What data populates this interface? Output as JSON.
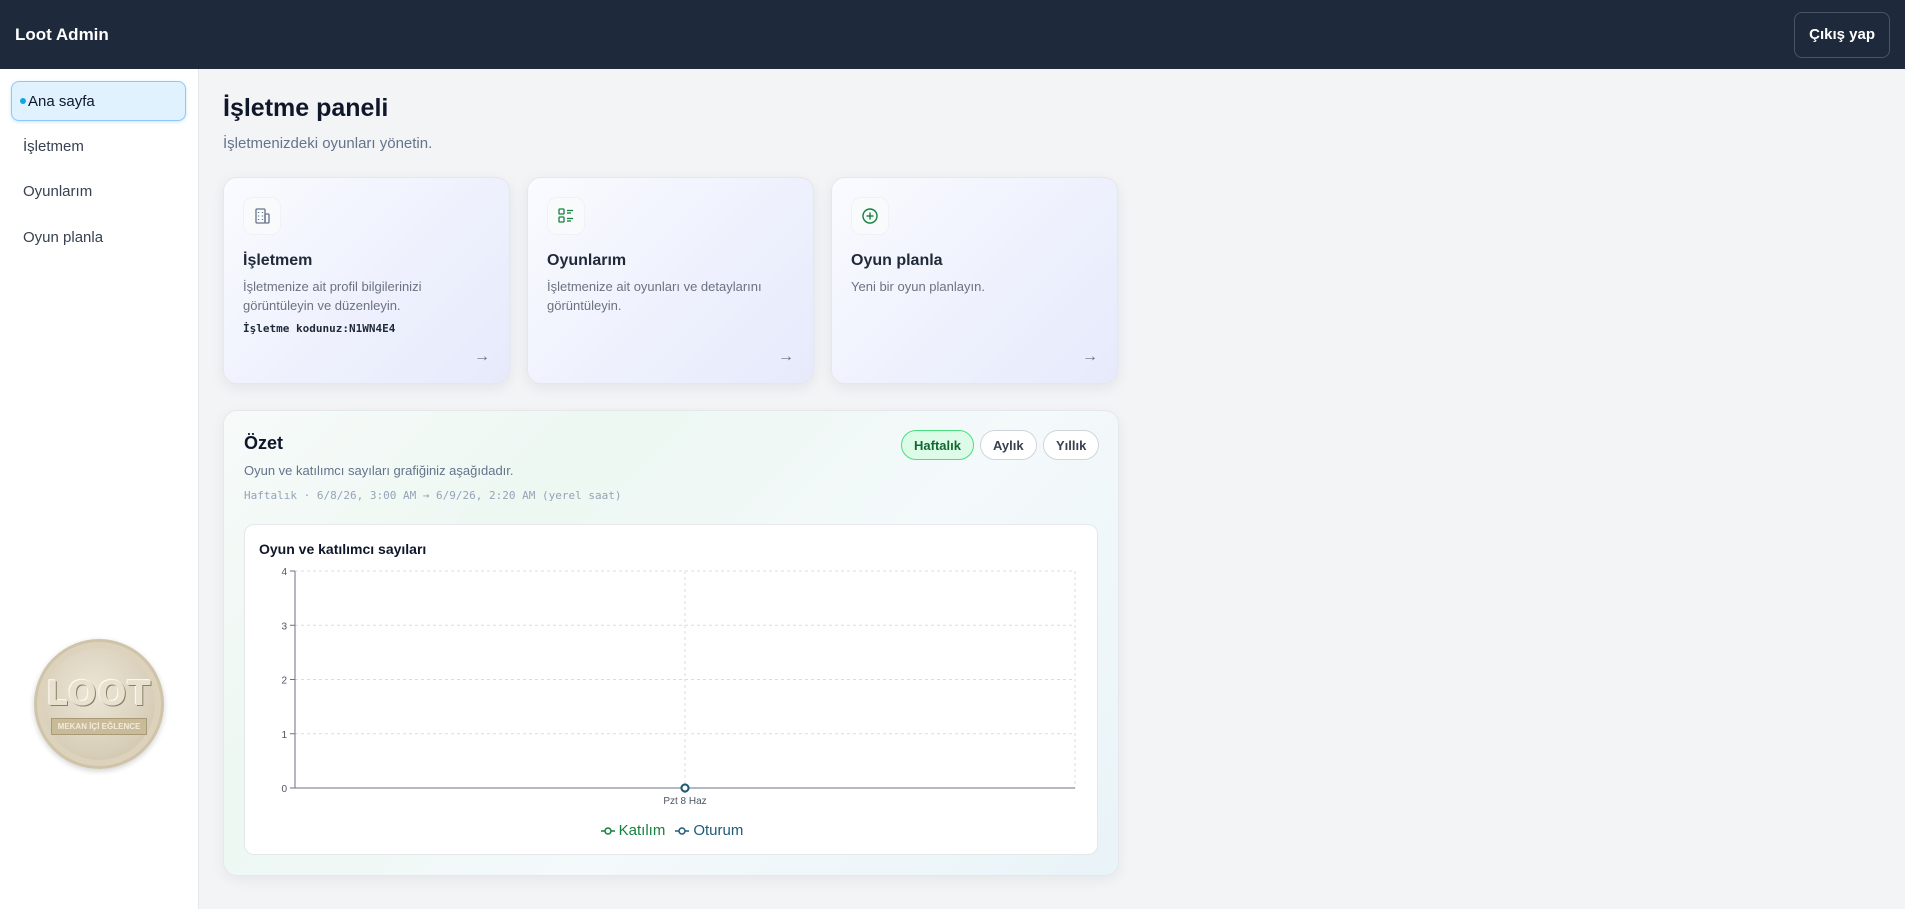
{
  "app": {
    "title": "Loot Admin",
    "logout_label": "Çıkış yap"
  },
  "sidebar": {
    "items": [
      {
        "label": "Ana sayfa",
        "active": true
      },
      {
        "label": "İşletmem",
        "active": false
      },
      {
        "label": "Oyunlarım",
        "active": false
      },
      {
        "label": "Oyun planla",
        "active": false
      }
    ],
    "coin_logo": {
      "text": "LOOT",
      "banner": "MEKAN İÇİ EĞLENCE"
    }
  },
  "main": {
    "title": "İşletme paneli",
    "subtitle": "İşletmenizdeki oyunları yönetin.",
    "cards": [
      {
        "title": "İşletmem",
        "description": "İşletmenize ait profil bilgilerinizi görüntüleyin ve düzenleyin.",
        "code_label": "İşletme kodunuz:",
        "code": "N1WN4E4",
        "icon": "building-icon"
      },
      {
        "title": "Oyunlarım",
        "description": "İşletmenize ait oyunları ve detaylarını görüntüleyin.",
        "icon": "list-icon"
      },
      {
        "title": "Oyun planla",
        "description": "Yeni bir oyun planlayın.",
        "icon": "plus-circle-icon"
      }
    ],
    "summary": {
      "title": "Özet",
      "description": "Oyun ve katılımcı sayıları grafiğiniz aşağıdadır.",
      "range": "Haftalık · 6/8/26, 3:00 AM → 6/9/26, 2:20 AM (yerel saat)",
      "periods": [
        "Haftalık",
        "Aylık",
        "Yıllık"
      ],
      "active_period": "Haftalık"
    }
  },
  "chart_data": {
    "type": "line",
    "title": "Oyun ve katılımcı sayıları",
    "categories": [
      "Pzt 8 Haz"
    ],
    "series": [
      {
        "name": "Katılım",
        "values": [
          0
        ],
        "color": "#15803d"
      },
      {
        "name": "Oturum",
        "values": [
          0
        ],
        "color": "#1e5a7a"
      }
    ],
    "ylim": [
      0,
      4
    ],
    "yticks": [
      0,
      1,
      2,
      3,
      4
    ],
    "grid": true,
    "legend": "bottom-center"
  },
  "colors": {
    "topbar": "#1e293b",
    "accent_green": "#15803d",
    "accent_blue": "#0ea5e9"
  }
}
